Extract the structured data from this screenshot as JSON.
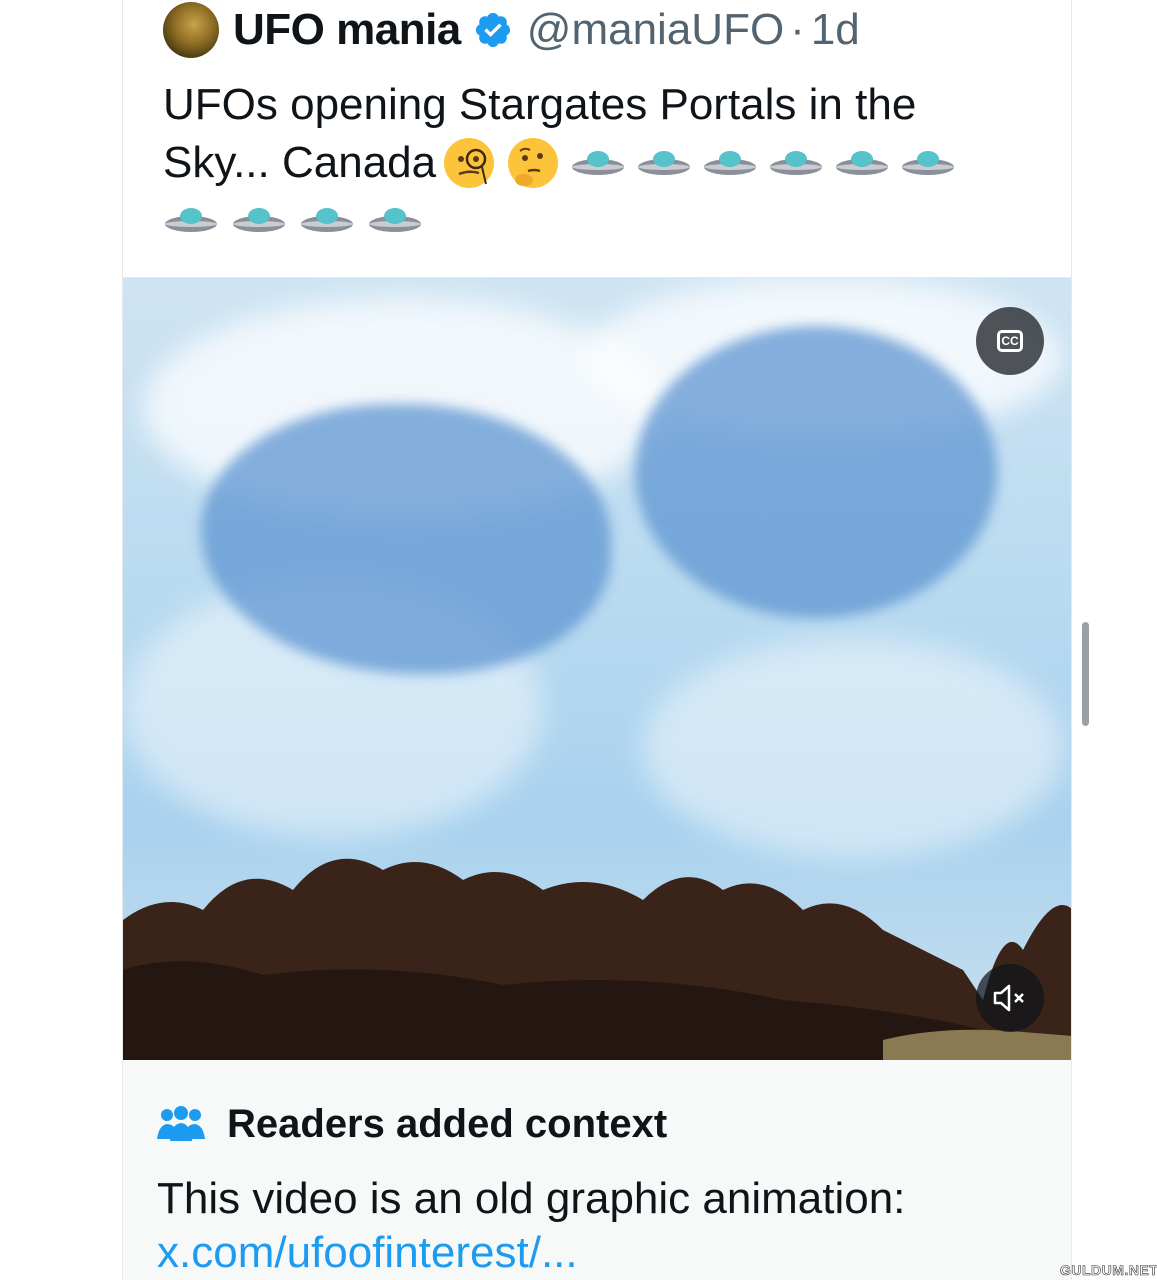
{
  "tweet": {
    "display_name": "UFO mania",
    "handle": "@maniaUFO",
    "separator": "·",
    "time": "1d",
    "text_line1": "UFOs opening Stargates Portals in the",
    "text_line2": "Sky... Canada",
    "emojis": [
      "monocle-face",
      "thinking-face",
      "flying-saucer x10"
    ]
  },
  "media": {
    "cc_label": "CC"
  },
  "context": {
    "title": "Readers added context",
    "body": "This video is an old graphic animation:",
    "link": "x.com/ufoofinterest/..."
  },
  "watermark": "GULDUM.NET",
  "colors": {
    "text": "#0f1419",
    "secondary": "#536471",
    "link": "#1d9bf0",
    "verified": "#1d9bf0",
    "context_bg": "#f7f9f9"
  }
}
